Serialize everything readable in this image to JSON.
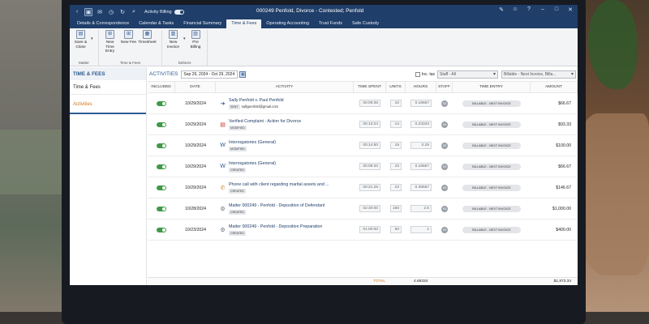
{
  "app": {
    "activity_billing_label": "Activity Billing",
    "window_title": "000249 Penfold, Divorce - Contested; Penfold"
  },
  "tabs": [
    {
      "label": "Details & Correspondence",
      "active": false
    },
    {
      "label": "Calendar & Tasks",
      "active": false
    },
    {
      "label": "Financial Summary",
      "active": false
    },
    {
      "label": "Time & Fees",
      "active": true
    },
    {
      "label": "Operating Accounting",
      "active": false
    },
    {
      "label": "Trust Funds",
      "active": false
    },
    {
      "label": "Safe Custody",
      "active": false
    }
  ],
  "ribbon": {
    "matter_group": "Matter",
    "save_close": "Save & Close",
    "time_fees_group": "Time & Fees",
    "new_time_entry": "New Time Entry",
    "new_fee": "New Fee",
    "timesheet": "Timesheet",
    "debtors_group": "Debtors",
    "new_invoice": "New Invoice",
    "pre_billing": "Pre Billing"
  },
  "sidebar": {
    "heading": "TIME & FEES",
    "items": [
      {
        "label": "Time & Fees",
        "selected": false
      },
      {
        "label": "Activities",
        "selected": true
      }
    ]
  },
  "filters": {
    "activities_label": "ACTIVITIES",
    "date_range": "Sep 29, 2024 - Oct 29, 2024",
    "inc_tax_label": "Inc. tax",
    "staff_value": "Staff - All",
    "billing_value": "Billable - Next Invoice, Billa..."
  },
  "columns": {
    "included": "INCLUDED",
    "date": "DATE",
    "activity": "ACTIVITY",
    "time_spent": "TIME SPENT",
    "units": "UNITS",
    "hours": "HOURS",
    "staff": "STAFF",
    "time_entry": "TIME ENTRY",
    "amount": "AMOUNT"
  },
  "rows": [
    {
      "date": "10/29/2024",
      "icon": "email-arrow-icon",
      "title": "Sally Penfold v. Paul Penfold",
      "badge": "SENT",
      "extra": "sallypenfold@gmail.com",
      "time": "00:09:36",
      "units": "10",
      "hours": "0.16667",
      "staff": "SS",
      "entry": "BILLABLE - NEXT INVOICE",
      "amount": "$66.67"
    },
    {
      "date": "10/29/2024",
      "icon": "pdf-icon",
      "title": "Verified Complaint - Action for Divorce",
      "badge": "MODIFIED",
      "extra": "",
      "time": "00:13:24",
      "units": "14",
      "hours": "0.23333",
      "staff": "SS",
      "entry": "BILLABLE - NEXT INVOICE",
      "amount": "$93.33"
    },
    {
      "date": "10/29/2024",
      "icon": "word-icon",
      "title": "Interrogatories (General)",
      "badge": "MODIFIED",
      "extra": "",
      "time": "00:14:50",
      "units": "15",
      "hours": "0.25",
      "staff": "SS",
      "entry": "BILLABLE - NEXT INVOICE",
      "amount": "$100.00"
    },
    {
      "date": "10/29/2024",
      "icon": "word-icon",
      "title": "Interrogatories (General)",
      "badge": "CREATED",
      "extra": "",
      "time": "00:09:20",
      "units": "10",
      "hours": "0.16667",
      "staff": "SS",
      "entry": "BILLABLE - NEXT INVOICE",
      "amount": "$66.67"
    },
    {
      "date": "10/29/2024",
      "icon": "phone-note-icon",
      "title": "Phone call with client regarding marital assets and ...",
      "badge": "CREATED",
      "extra": "",
      "time": "00:21:25",
      "units": "22",
      "hours": "0.36667",
      "staff": "SS",
      "entry": "BILLABLE - NEXT INVOICE",
      "amount": "$146.67"
    },
    {
      "date": "10/28/2024",
      "icon": "matter-gear-icon",
      "title": "Matter 000249 - Penfold - Deposition of Defendant",
      "badge": "CREATED",
      "extra": "",
      "time": "02:30:00",
      "units": "150",
      "hours": "2.5",
      "staff": "SS",
      "entry": "BILLABLE - NEXT INVOICE",
      "amount": "$1,000.00"
    },
    {
      "date": "10/23/2024",
      "icon": "matter-gear-icon",
      "title": "Matter 000249 - Penfold - Deposition Preparation",
      "badge": "CREATED",
      "extra": "",
      "time": "01:00:00",
      "units": "60",
      "hours": "1",
      "staff": "SS",
      "entry": "BILLABLE - NEXT INVOICE",
      "amount": "$400.00"
    }
  ],
  "totals": {
    "label": "TOTAL",
    "hours": "4.68334",
    "amount": "$1,873.34"
  },
  "colors": {
    "titlebar": "#1f3e69",
    "accent_orange": "#d4761f",
    "toggle_on": "#3f9a48"
  }
}
